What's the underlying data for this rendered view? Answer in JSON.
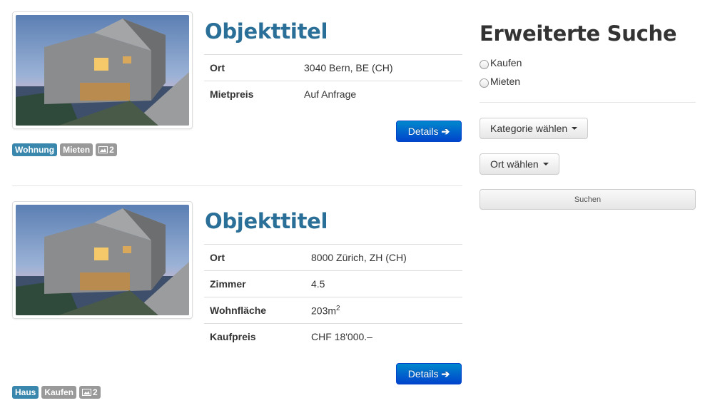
{
  "listings": [
    {
      "title": "Objekttitel",
      "badges": {
        "type": "Wohnung",
        "offer": "Mieten",
        "images": "2"
      },
      "properties": [
        {
          "key": "Ort",
          "value": "3040 Bern, BE (CH)"
        },
        {
          "key": "Mietpreis",
          "value": "Auf Anfrage"
        }
      ],
      "details_label": "Details"
    },
    {
      "title": "Objekttitel",
      "badges": {
        "type": "Haus",
        "offer": "Kaufen",
        "images": "2"
      },
      "properties": [
        {
          "key": "Ort",
          "value": "8000 Zürich, ZH (CH)"
        },
        {
          "key": "Zimmer",
          "value": "4.5"
        },
        {
          "key": "Wohnfläche",
          "value": "203m",
          "sup": "2"
        },
        {
          "key": "Kaufpreis",
          "value": "CHF 18'000.–"
        }
      ],
      "details_label": "Details"
    }
  ],
  "sidebar": {
    "heading": "Erweiterte Suche",
    "radios": [
      "Kaufen",
      "Mieten"
    ],
    "category_label": "Kategorie wählen",
    "location_label": "Ort wählen",
    "search_label": "Suchen"
  },
  "colors": {
    "title": "#2a6f97",
    "badge_type": "#3a87ad",
    "badge_grey": "#999999",
    "primary_button": "#0066cc"
  },
  "icons": {
    "arrow": "arrow-right-icon",
    "images": "image-icon",
    "caret": "caret-down-icon"
  }
}
